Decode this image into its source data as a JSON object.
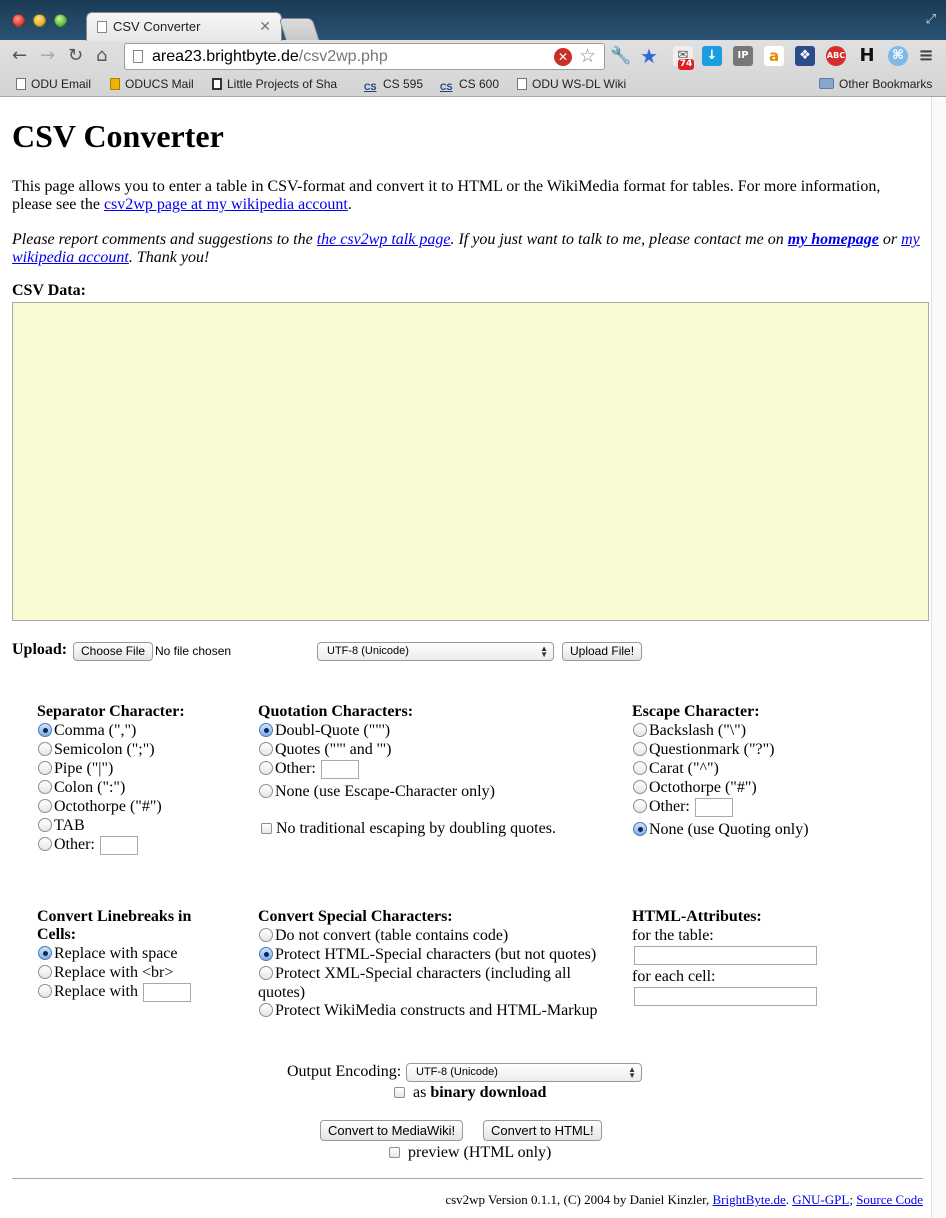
{
  "browser": {
    "tab_title": "CSV Converter",
    "url_host": "area23.brightbyte.de",
    "url_path": "/csv2wp.php",
    "extension_badge": "74",
    "bookmarks": [
      {
        "label": "ODU Email",
        "icon": "page-icon"
      },
      {
        "label": "ODUCS Mail",
        "icon": "outlook-icon"
      },
      {
        "label": "Little Projects of Sha",
        "icon": "box-icon"
      },
      {
        "label": "CS 595",
        "icon": "cs-icon"
      },
      {
        "label": "CS 600",
        "icon": "cs-icon"
      },
      {
        "label": "ODU WS-DL Wiki",
        "icon": "page-icon"
      }
    ],
    "other_bookmarks": "Other Bookmarks"
  },
  "page": {
    "title": "CSV Converter",
    "intro_text": "This page allows you to enter a table in CSV-format and convert it to HTML or the WikiMedia format for tables. For more information, please see the ",
    "intro_link": "csv2wp page at my wikipedia account",
    "intro_end": ".",
    "report_text_1": "Please report comments and suggestions to the ",
    "report_link_talk": "the csv2wp talk page",
    "report_text_2": ". If you just want to talk to me, please contact me on ",
    "report_link_home": "my homepage",
    "report_text_3": " or ",
    "report_link_wiki": "my wikipedia account",
    "report_text_4": ". Thank you!",
    "csv_label": "CSV Data:",
    "csv_value": "",
    "upload_label": "Upload:",
    "choose_file": "Choose File",
    "no_file": "No file chosen",
    "upload_encoding": "UTF-8 (Unicode)",
    "upload_button": "Upload File!"
  },
  "separator": {
    "heading": "Separator Character:",
    "options": [
      "Comma (\",\")",
      "Semicolon (\";\")",
      "Pipe (\"|\")",
      "Colon (\":\")",
      "Octothorpe (\"#\")",
      "TAB",
      "Other:"
    ],
    "selected": 0
  },
  "quotation": {
    "heading": "Quotation Characters:",
    "options": [
      "Doubl-Quote (\"\"')",
      "Quotes (\"\"' and '\")",
      "Other:",
      "None (use Escape-Character only)"
    ],
    "no_doubling": "No traditional escaping by doubling quotes.",
    "selected": 0
  },
  "escape": {
    "heading": "Escape Character:",
    "options": [
      "Backslash (\"\\\")",
      "Questionmark (\"?\")",
      "Carat (\"^\")",
      "Octothorpe (\"#\")",
      "Other:",
      "None (use Quoting only)"
    ],
    "selected": 5
  },
  "linebreaks": {
    "heading": "Convert Linebreaks in Cells:",
    "options": [
      "Replace with space",
      "Replace with <br>",
      "Replace with"
    ],
    "selected": 0
  },
  "special": {
    "heading": "Convert Special Characters:",
    "options": [
      "Do not convert (table contains code)",
      "Protect HTML-Special characters (but not quotes)",
      "Protect XML-Special characters (including all quotes)",
      "Protect WikiMedia constructs and HTML-Markup"
    ],
    "selected": 1
  },
  "attributes": {
    "heading": "HTML-Attributes:",
    "table_label": "for the table:",
    "cell_label": "for each cell:",
    "table_value": "",
    "cell_value": ""
  },
  "output": {
    "encoding_label": "Output Encoding:",
    "encoding_value": "UTF-8 (Unicode)",
    "binary_prefix": "as ",
    "binary_label": "binary download",
    "convert_mediawiki": "Convert to MediaWiki!",
    "convert_html": "Convert to HTML!",
    "preview_label": "preview (HTML only)"
  },
  "footer": {
    "text": "csv2wp Version 0.1.1, (C) 2004 by Daniel Kinzler, ",
    "link_brightbyte": "BrightByte.de",
    "sep1": ". ",
    "link_gpl": "GNU-GPL",
    "sep2": "; ",
    "link_source": "Source Code"
  }
}
